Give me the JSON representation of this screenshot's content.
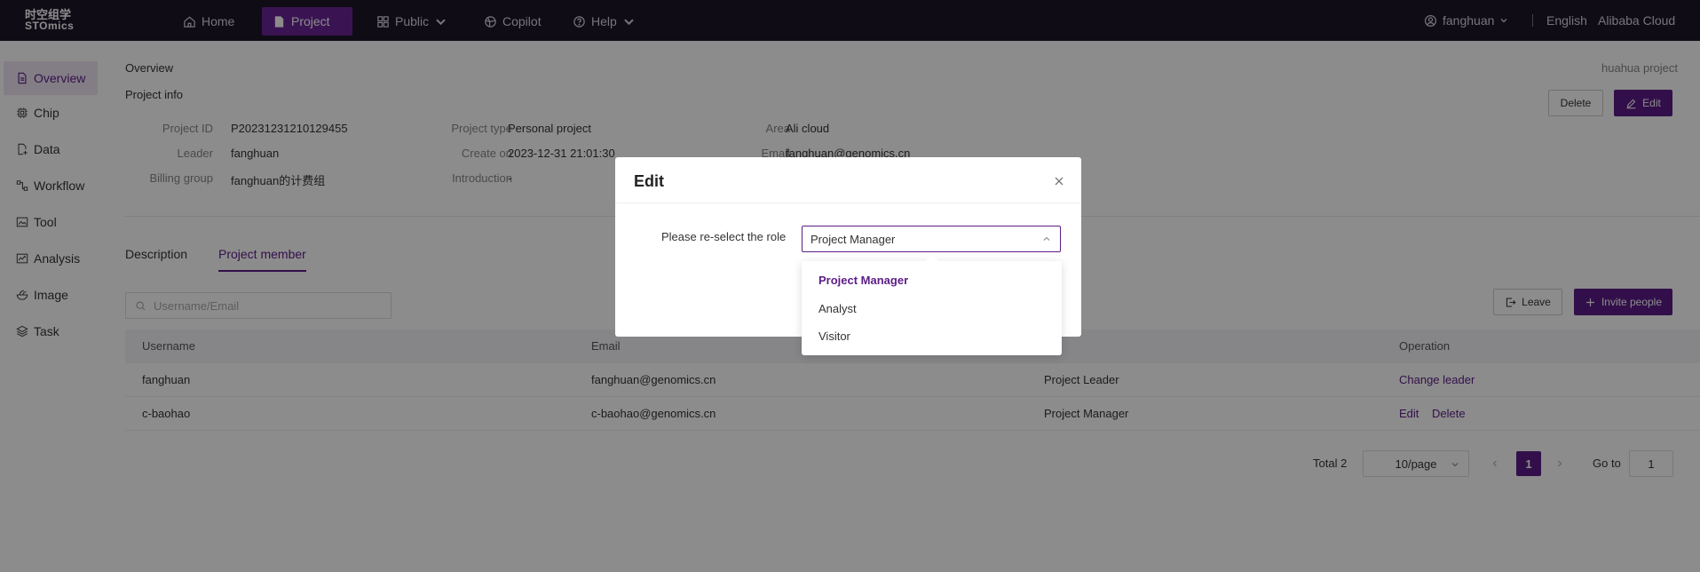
{
  "topbar": {
    "logo_line1": "时空组学",
    "logo_line2": "STOmics",
    "nav": {
      "home": "Home",
      "project": "Project",
      "public": "Public",
      "copilot": "Copilot",
      "help": "Help"
    },
    "user": "fanghuan",
    "language": "English",
    "cloud": "Alibaba Cloud"
  },
  "sidebar": {
    "items": [
      "Overview",
      "Chip",
      "Data",
      "Workflow",
      "Tool",
      "Analysis",
      "Image",
      "Task"
    ],
    "active": "Overview"
  },
  "main": {
    "breadcrumb": "Overview",
    "project_name": "huahua project",
    "section_title": "Project info",
    "delete_label": "Delete",
    "edit_label": "Edit",
    "info": {
      "project_id_label": "Project ID",
      "project_id": "P20231231210129455",
      "leader_label": "Leader",
      "leader": "fanghuan",
      "billing_label": "Billing group",
      "billing": "fanghuan的计费组",
      "type_label": "Project type",
      "type": "Personal project",
      "create_label": "Create on",
      "create": "2023-12-31 21:01:30",
      "intro_label": "Introduction",
      "intro": "-",
      "area_label": "Area",
      "area": "Ali cloud",
      "email_label": "Email",
      "email": "fanghuan@genomics.cn"
    },
    "tabs": [
      "Description",
      "Project member"
    ],
    "active_tab": "Project member",
    "search_placeholder": "Username/Email",
    "leave_label": "Leave",
    "invite_label": "Invite people",
    "table": {
      "headers": [
        "Username",
        "Email",
        "Role",
        "Operation"
      ],
      "role_header_visible": "e",
      "rows": [
        {
          "username": "fanghuan",
          "email": "fanghuan@genomics.cn",
          "role": "Project Leader",
          "ops": [
            "Change leader"
          ]
        },
        {
          "username": "c-baohao",
          "email": "c-baohao@genomics.cn",
          "role": "Project Manager",
          "ops": [
            "Edit",
            "Delete"
          ]
        }
      ]
    },
    "pagination": {
      "total": "Total 2",
      "page_size": "10/page",
      "current_page": "1",
      "goto_label": "Go to",
      "goto_value": "1"
    }
  },
  "modal": {
    "title": "Edit",
    "role_label": "Please re-select the role",
    "selected_role": "Project Manager",
    "options": [
      "Project Manager",
      "Analyst",
      "Visitor"
    ]
  },
  "colors": {
    "topbar_bg": "#1e1629",
    "accent": "#5c1d87",
    "active_nav": "#6a2596"
  }
}
